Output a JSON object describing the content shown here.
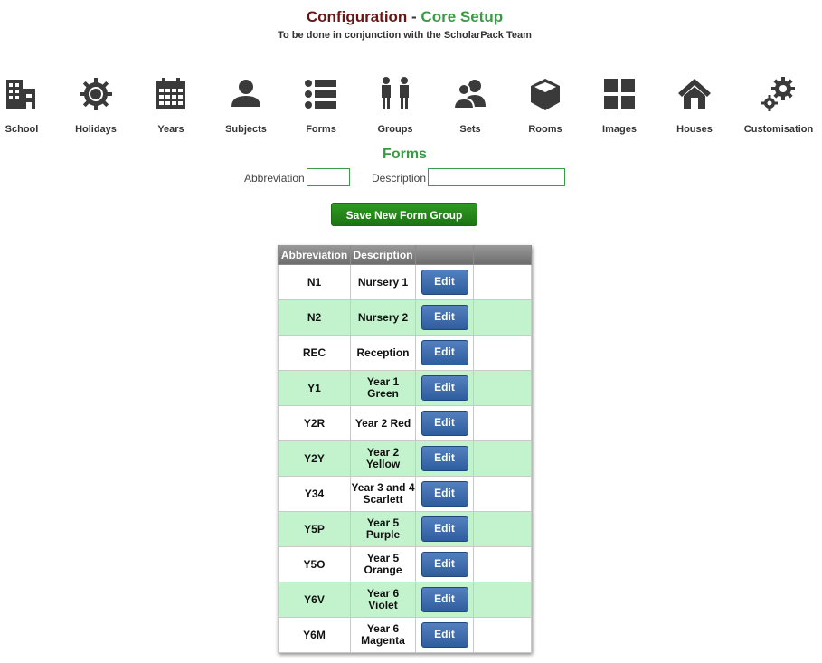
{
  "header": {
    "title_part1": "Configuration",
    "title_sep": " - ",
    "title_part2": "Core Setup",
    "subtitle": "To be done in conjunction with the ScholarPack Team"
  },
  "nav": [
    {
      "label": "School",
      "icon": "building-icon"
    },
    {
      "label": "Holidays",
      "icon": "sun-icon"
    },
    {
      "label": "Years",
      "icon": "calendar-icon"
    },
    {
      "label": "Subjects",
      "icon": "person-icon"
    },
    {
      "label": "Forms",
      "icon": "list-icon"
    },
    {
      "label": "Groups",
      "icon": "people-icon"
    },
    {
      "label": "Sets",
      "icon": "users-icon"
    },
    {
      "label": "Rooms",
      "icon": "cube-icon"
    },
    {
      "label": "Images",
      "icon": "grid-icon"
    },
    {
      "label": "Houses",
      "icon": "house-icon"
    },
    {
      "label": "Customisation",
      "icon": "gears-icon"
    }
  ],
  "forms_section": {
    "heading": "Forms",
    "abbreviation_label": "Abbreviation",
    "abbreviation_value": "",
    "description_label": "Description",
    "description_value": "",
    "save_button": "Save New Form Group"
  },
  "table": {
    "headers": [
      "Abbreviation",
      "Description",
      "",
      ""
    ],
    "edit_label": "Edit",
    "rows": [
      {
        "abbr": "N1",
        "desc": "Nursery 1"
      },
      {
        "abbr": "N2",
        "desc": "Nursery 2"
      },
      {
        "abbr": "REC",
        "desc": "Reception"
      },
      {
        "abbr": "Y1",
        "desc": "Year 1 Green"
      },
      {
        "abbr": "Y2R",
        "desc": "Year 2 Red"
      },
      {
        "abbr": "Y2Y",
        "desc": "Year 2 Yellow"
      },
      {
        "abbr": "Y34",
        "desc": "Year 3 and 4 Scarlett"
      },
      {
        "abbr": "Y5P",
        "desc": "Year 5 Purple"
      },
      {
        "abbr": "Y5O",
        "desc": "Year 5 Orange"
      },
      {
        "abbr": "Y6V",
        "desc": "Year 6 Violet"
      },
      {
        "abbr": "Y6M",
        "desc": "Year 6 Magenta"
      }
    ]
  },
  "colors": {
    "title_maroon": "#6b1414",
    "title_green": "#3a9b46",
    "row_alt": "#c3f3cd",
    "edit_button": "#3d6aab",
    "save_button": "#258a1a"
  }
}
